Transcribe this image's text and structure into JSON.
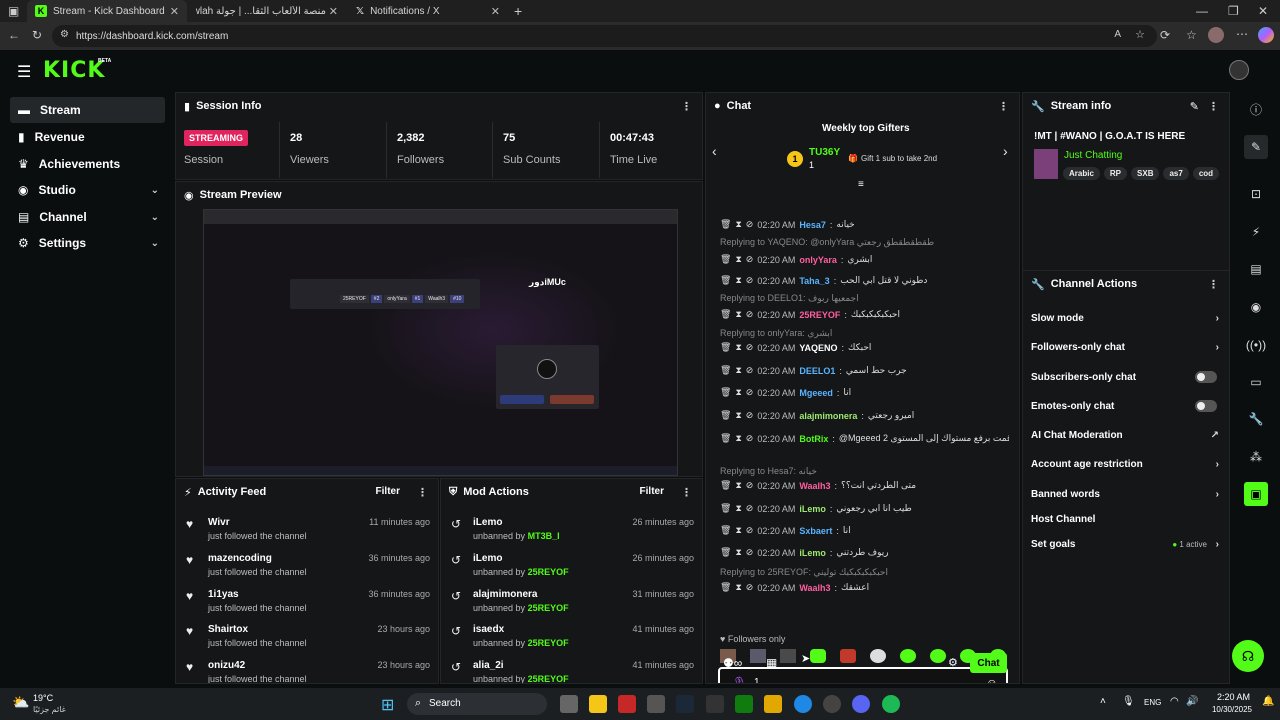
{
  "browser": {
    "tabs": [
      {
        "title": "Stream - Kick Dashboard"
      },
      {
        "title": "منصة الألعاب الثقا... | جولة Jawlah -"
      },
      {
        "title": "Notifications / X"
      }
    ],
    "url": "https://dashboard.kick.com/stream"
  },
  "app": {
    "logo": "KICK",
    "beta": "BETA"
  },
  "sidebar": {
    "items": [
      {
        "label": "Stream",
        "icon": "stream-icon"
      },
      {
        "label": "Revenue",
        "icon": "revenue-icon"
      },
      {
        "label": "Achievements",
        "icon": "trophy-icon"
      },
      {
        "label": "Studio",
        "icon": "studio-icon"
      },
      {
        "label": "Channel",
        "icon": "channel-icon"
      },
      {
        "label": "Settings",
        "icon": "gear-icon"
      }
    ]
  },
  "session": {
    "title": "Session Info",
    "status": "STREAMING",
    "status_label": "Session",
    "stats": [
      {
        "value": "28",
        "label": "Viewers"
      },
      {
        "value": "2,382",
        "label": "Followers"
      },
      {
        "value": "75",
        "label": "Sub Counts"
      },
      {
        "value": "00:47:43",
        "label": "Time Live"
      }
    ]
  },
  "preview": {
    "title": "Stream Preview",
    "game_title": "دورiMUc",
    "slots": [
      "25REYOF",
      "#2",
      "onlyYara",
      "#1",
      "Waalh3",
      "#10"
    ]
  },
  "activity": {
    "title": "Activity Feed",
    "filter": "Filter",
    "items": [
      {
        "name": "Wivr",
        "sub": "just followed the channel",
        "time": "11 minutes ago"
      },
      {
        "name": "mazencoding",
        "sub": "just followed the channel",
        "time": "36 minutes ago"
      },
      {
        "name": "1i1yas",
        "sub": "just followed the channel",
        "time": "36 minutes ago"
      },
      {
        "name": "Shairtox",
        "sub": "just followed the channel",
        "time": "23 hours ago"
      },
      {
        "name": "onizu42",
        "sub": "just followed the channel",
        "time": "23 hours ago"
      }
    ]
  },
  "mod": {
    "title": "Mod Actions",
    "filter": "Filter",
    "items": [
      {
        "name": "iLemo",
        "pre": "unbanned by",
        "by": "MT3B_I",
        "time": "26 minutes ago"
      },
      {
        "name": "iLemo",
        "pre": "unbanned by",
        "by": "25REYOF",
        "time": "26 minutes ago"
      },
      {
        "name": "alajmimonera",
        "pre": "unbanned by",
        "by": "25REYOF",
        "time": "31 minutes ago"
      },
      {
        "name": "isaedx",
        "pre": "unbanned by",
        "by": "25REYOF",
        "time": "41 minutes ago"
      },
      {
        "name": "alia_2i",
        "pre": "unbanned by",
        "by": "25REYOF",
        "time": "41 minutes ago"
      }
    ]
  },
  "chat": {
    "title": "Chat",
    "gifters_title": "Weekly top Gifters",
    "top_gifter": "TU36Y",
    "top_rank": "1",
    "top_count": "1",
    "gift_hint": "Gift 1 sub to take 2nd",
    "messages": [
      {
        "time": "02:20 AM",
        "user": "Hesa7",
        "color": "#5ab4ff",
        "text": "خيانه"
      },
      {
        "reply": "Replying to YAQENO: @onlyYara طقطقطقطق رجعتي"
      },
      {
        "time": "02:20 AM",
        "user": "onlyYara",
        "color": "#ff5fa2",
        "text": "ابشري"
      },
      {
        "time": "02:20 AM",
        "user": "Taha_3",
        "color": "#5ab4ff",
        "text": "دطوني لا قتل ابي الحب"
      },
      {
        "reply": "Replying to DEELO1: اجمعيها ربوف"
      },
      {
        "time": "02:20 AM",
        "user": "25REYOF",
        "color": "#ff5fa2",
        "text": "احبكبكبكبكبك"
      },
      {
        "reply": "Replying to onlyYara: ابشري"
      },
      {
        "time": "02:20 AM",
        "user": "YAQENO",
        "color": "#ffffff",
        "text": "احبكك"
      },
      {
        "time": "02:20 AM",
        "user": "DEELO1",
        "color": "#5ab4ff",
        "text": "جرب حط اسمي"
      },
      {
        "time": "02:20 AM",
        "user": "Mgeeed",
        "color": "#5ab4ff",
        "text": "انا"
      },
      {
        "time": "02:20 AM",
        "user": "alajmimonera",
        "color": "#9fe870",
        "text": "اميرو رجعتي"
      },
      {
        "time": "02:20 AM",
        "user": "BotRix",
        "color": "#53fc18",
        "text": "@Mgeeed قمت برفع مستواك إلى المستوى 2"
      },
      {
        "reply": "Replying to Hesa7: خيانه"
      },
      {
        "time": "02:20 AM",
        "user": "Waalh3",
        "color": "#ff5fa2",
        "text": "متى الطردتي انت؟؟"
      },
      {
        "time": "02:20 AM",
        "user": "iLemo",
        "color": "#9fe870",
        "text": "طيب انا ابي رجعوني"
      },
      {
        "time": "02:20 AM",
        "user": "Sxbaert",
        "color": "#5ab4ff",
        "text": "انا"
      },
      {
        "time": "02:20 AM",
        "user": "iLemo",
        "color": "#9fe870",
        "text": "ريوف طردتني"
      },
      {
        "reply": "Replying to 25REYOF: احبكبكبكبكبك توليني"
      },
      {
        "time": "02:20 AM",
        "user": "Waalh3",
        "color": "#ff5fa2",
        "text": "اعشقك"
      }
    ],
    "followers_only": "Followers only",
    "input_value": "1",
    "send": "Chat"
  },
  "streaminfo": {
    "title": "Stream info",
    "stream_title": "!MT | #WANO | G.O.A.T IS HERE",
    "category": "Just Chatting",
    "tags": [
      "Arabic",
      "RP",
      "SXB",
      "as7",
      "cod"
    ]
  },
  "channel_actions": {
    "title": "Channel Actions",
    "items": [
      {
        "label": "Slow mode",
        "kind": "chevron"
      },
      {
        "label": "Followers-only chat",
        "kind": "chevron"
      },
      {
        "label": "Subscribers-only chat",
        "kind": "toggle"
      },
      {
        "label": "Emotes-only chat",
        "kind": "toggle"
      },
      {
        "label": "AI Chat Moderation",
        "kind": "external"
      },
      {
        "label": "Account age restriction",
        "kind": "chevron"
      },
      {
        "label": "Banned words",
        "kind": "chevron"
      },
      {
        "label": "Host Channel",
        "kind": "none"
      },
      {
        "label": "Set goals",
        "kind": "chevron",
        "note": "1 active"
      }
    ]
  },
  "taskbar": {
    "temp": "19°C",
    "weather": "غائم جزئيًا",
    "search": "Search",
    "lang": "ENG",
    "time": "2:20 AM",
    "date": "10/30/2025"
  },
  "colors": {
    "brand": "#53fc18",
    "streaming": "#e0245e"
  }
}
